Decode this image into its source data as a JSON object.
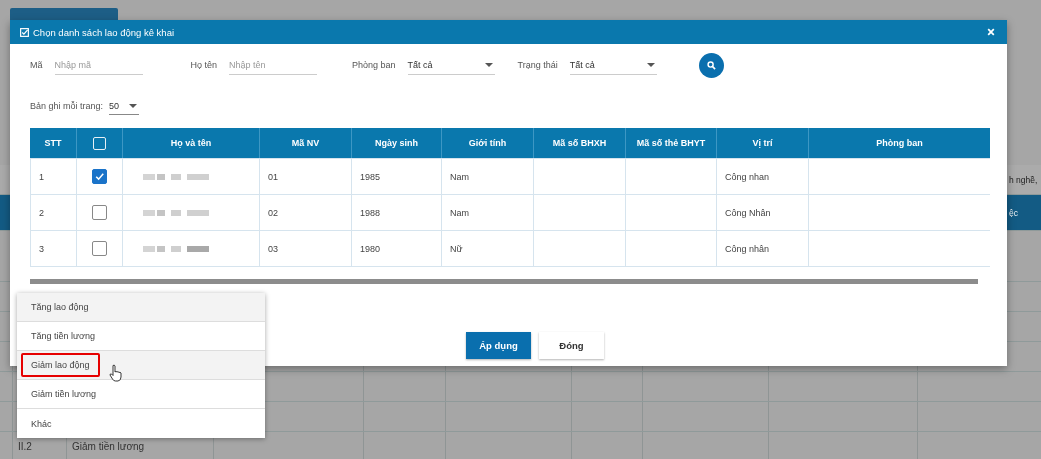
{
  "background": {
    "right_header_texts": [
      "h nghề,",
      "ệc"
    ],
    "last_row": {
      "code": "II.2",
      "name": "Giảm tiền lương"
    }
  },
  "dialog": {
    "title": "Chọn danh sách lao động kê khai",
    "filters": [
      {
        "kind": "input",
        "label": "Mã",
        "placeholder": "Nhập mã"
      },
      {
        "kind": "input",
        "label": "Họ tên",
        "placeholder": "Nhập tên"
      },
      {
        "kind": "select",
        "label": "Phòng ban",
        "value": "Tất cả"
      },
      {
        "kind": "select",
        "label": "Trạng thái",
        "value": "Tất cả"
      }
    ],
    "page_size": {
      "label": "Bản ghi mỗi trang:",
      "value": "50"
    },
    "table": {
      "columns": [
        "STT",
        "Họ và tên",
        "Mã NV",
        "Ngày sinh",
        "Giới tính",
        "Mã số BHXH",
        "Mã số thẻ BHYT",
        "Vị trí",
        "Phòng ban"
      ],
      "header_checkbox": {
        "checked": false
      },
      "rows": [
        {
          "stt": "1",
          "checked": true,
          "ma_nv": "01",
          "ngay_sinh": "1985",
          "gioi_tinh": "Nam",
          "vi_tri": "Công nhan"
        },
        {
          "stt": "2",
          "checked": false,
          "ma_nv": "02",
          "ngay_sinh": "1988",
          "gioi_tinh": "Nam",
          "vi_tri": "Công Nhân"
        },
        {
          "stt": "3",
          "checked": false,
          "ma_nv": "03",
          "ngay_sinh": "1980",
          "gioi_tinh": "Nữ",
          "vi_tri": "Công nhân"
        }
      ]
    },
    "buttons": [
      {
        "kind": "primary",
        "label": "Áp dụng"
      },
      {
        "kind": "default",
        "label": "Đóng"
      }
    ]
  },
  "menu": {
    "items": [
      {
        "label": "Tăng lao động",
        "hovered": true,
        "highlighted": false
      },
      {
        "label": "Tăng tiền lương",
        "hovered": false,
        "highlighted": false
      },
      {
        "label": "Giảm lao động",
        "hovered": true,
        "highlighted": true
      },
      {
        "label": "Giảm tiền lương",
        "hovered": false,
        "highlighted": false
      },
      {
        "label": "Khác",
        "hovered": false,
        "highlighted": false
      }
    ]
  }
}
